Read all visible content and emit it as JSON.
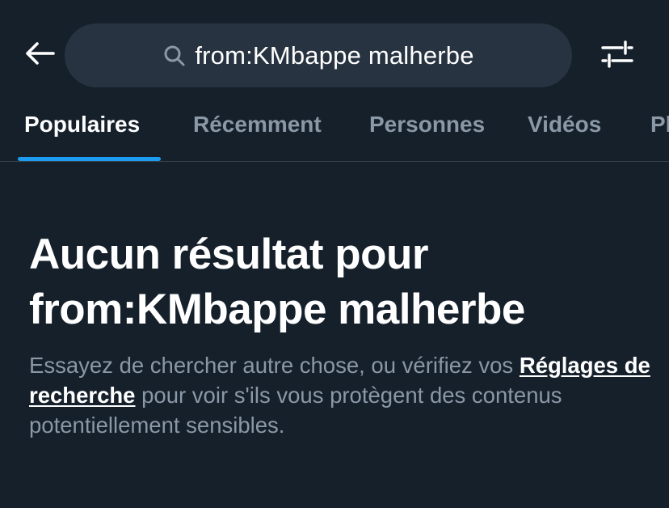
{
  "header": {
    "back_icon": "arrow-left-icon",
    "search": {
      "icon": "search-icon",
      "query": "from:KMbappe malherbe"
    },
    "filter_icon": "sliders-icon"
  },
  "tabs": [
    {
      "label": "Populaires",
      "active": true
    },
    {
      "label": "Récemment",
      "active": false
    },
    {
      "label": "Personnes",
      "active": false
    },
    {
      "label": "Vidéos",
      "active": false
    },
    {
      "label": "Photos",
      "active": false
    }
  ],
  "empty_state": {
    "title_line1": "Aucun résultat pour",
    "title_line2": "from:KMbappe malherbe",
    "desc_before": "Essayez de chercher autre chose, ou vérifiez vos ",
    "desc_link": "Réglages de recherche",
    "desc_after": " pour voir s'ils vous protègent des contenus potentiellement sensibles."
  },
  "colors": {
    "background": "#15202b",
    "search_bg": "#273340",
    "accent": "#1d9bf0",
    "muted_text": "#8b98a5",
    "text": "#ffffff"
  }
}
